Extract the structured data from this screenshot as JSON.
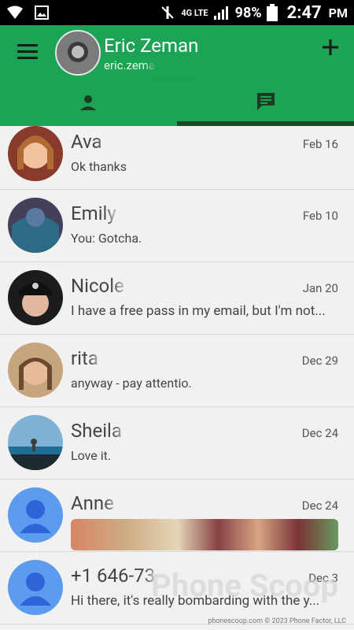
{
  "status_bar": {
    "battery": "98%",
    "time": "2:47",
    "ampm": "PM",
    "network": "4G LTE"
  },
  "account": {
    "name": "Eric Zeman",
    "email": "eric.zema"
  },
  "tabs": [
    {
      "name": "contacts",
      "icon": "person-icon",
      "active": false
    },
    {
      "name": "messages",
      "icon": "chat-icon",
      "active": true
    }
  ],
  "conversations": [
    {
      "name": "Ava",
      "date": "Feb 16",
      "snippet": "Ok thanks"
    },
    {
      "name": "Emily",
      "date": "Feb 10",
      "snippet": "You: Gotcha."
    },
    {
      "name": "Nicole",
      "date": "Jan 20",
      "snippet": "I have a free pass in my email, but I'm not..."
    },
    {
      "name": "rita",
      "date": "Dec 29",
      "snippet": "anyway - pay attentio."
    },
    {
      "name": "Sheila",
      "date": "Dec 24",
      "snippet": "Love it."
    },
    {
      "name": "Anne",
      "date": "Dec 24",
      "snippet": ""
    },
    {
      "name": "+1 646-73",
      "date": "Dec 3",
      "snippet": "Hi there, it's really bombarding with the y..."
    }
  ],
  "watermark": "Phone Scoop",
  "footer": "phonescoop.com  © 2023 Phone Factor, LLC",
  "colors": {
    "appbar": "#1da355",
    "indicator": "#1a4a1f",
    "default_avatar": "#5b9cf0"
  }
}
